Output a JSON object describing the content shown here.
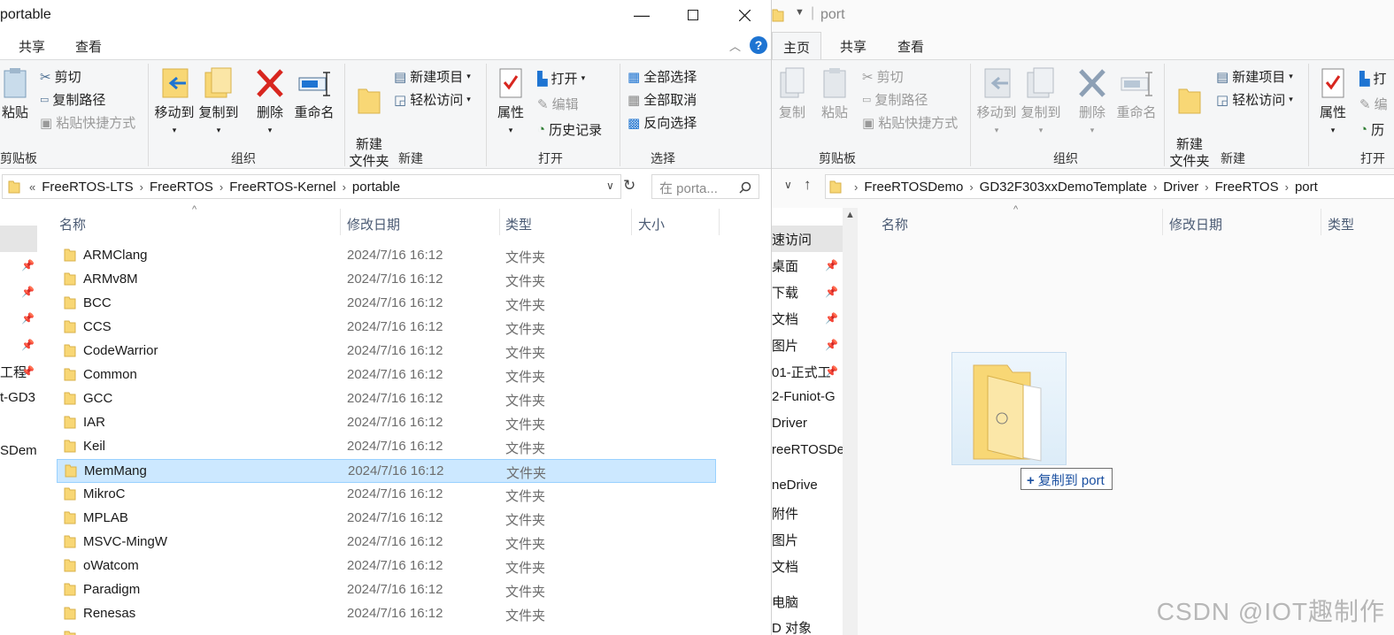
{
  "left_window": {
    "title": "portable",
    "tabs": [
      "共享",
      "查看"
    ],
    "ribbon": {
      "clipboard": {
        "group_label": "剪贴板",
        "paste": "粘贴",
        "cut": "剪切",
        "copy_path": "复制路径",
        "paste_shortcut": "粘贴快捷方式"
      },
      "organize": {
        "group_label": "组织",
        "move_to": "移动到",
        "copy_to": "复制到",
        "delete": "删除",
        "rename": "重命名"
      },
      "new": {
        "group_label": "新建",
        "new_folder": "新建\n文件夹",
        "new_item": "新建项目",
        "easy_access": "轻松访问"
      },
      "open": {
        "group_label": "打开",
        "properties": "属性",
        "open": "打开",
        "edit": "编辑",
        "history": "历史记录"
      },
      "select": {
        "group_label": "选择",
        "select_all": "全部选择",
        "select_none": "全部取消",
        "invert": "反向选择"
      }
    },
    "breadcrumbs": [
      "FreeRTOS-LTS",
      "FreeRTOS",
      "FreeRTOS-Kernel",
      "portable"
    ],
    "search_placeholder": "在 porta...",
    "columns": {
      "name": "名称",
      "date": "修改日期",
      "type": "类型",
      "size": "大小"
    },
    "nav_items": [
      "工程",
      "t-GD3",
      "SDem"
    ],
    "rows": [
      {
        "name": "ARMClang",
        "date": "2024/7/16 16:12",
        "type": "文件夹"
      },
      {
        "name": "ARMv8M",
        "date": "2024/7/16 16:12",
        "type": "文件夹"
      },
      {
        "name": "BCC",
        "date": "2024/7/16 16:12",
        "type": "文件夹"
      },
      {
        "name": "CCS",
        "date": "2024/7/16 16:12",
        "type": "文件夹"
      },
      {
        "name": "CodeWarrior",
        "date": "2024/7/16 16:12",
        "type": "文件夹"
      },
      {
        "name": "Common",
        "date": "2024/7/16 16:12",
        "type": "文件夹"
      },
      {
        "name": "GCC",
        "date": "2024/7/16 16:12",
        "type": "文件夹"
      },
      {
        "name": "IAR",
        "date": "2024/7/16 16:12",
        "type": "文件夹"
      },
      {
        "name": "Keil",
        "date": "2024/7/16 16:12",
        "type": "文件夹"
      },
      {
        "name": "MemMang",
        "date": "2024/7/16 16:12",
        "type": "文件夹",
        "selected": true
      },
      {
        "name": "MikroC",
        "date": "2024/7/16 16:12",
        "type": "文件夹"
      },
      {
        "name": "MPLAB",
        "date": "2024/7/16 16:12",
        "type": "文件夹"
      },
      {
        "name": "MSVC-MingW",
        "date": "2024/7/16 16:12",
        "type": "文件夹"
      },
      {
        "name": "oWatcom",
        "date": "2024/7/16 16:12",
        "type": "文件夹"
      },
      {
        "name": "Paradigm",
        "date": "2024/7/16 16:12",
        "type": "文件夹"
      },
      {
        "name": "Renesas",
        "date": "2024/7/16 16:12",
        "type": "文件夹"
      }
    ]
  },
  "right_window": {
    "title": "port",
    "tabs": [
      "主页",
      "共享",
      "查看"
    ],
    "ribbon": {
      "clipboard": {
        "group_label": "剪贴板",
        "copy": "复制",
        "paste": "粘贴",
        "cut": "剪切",
        "copy_path": "复制路径",
        "paste_shortcut": "粘贴快捷方式"
      },
      "organize": {
        "group_label": "组织",
        "move_to": "移动到",
        "copy_to": "复制到",
        "delete": "删除",
        "rename": "重命名"
      },
      "new": {
        "group_label": "新建",
        "new_folder": "新建\n文件夹",
        "new_item": "新建项目",
        "easy_access": "轻松访问"
      },
      "open": {
        "group_label": "打开",
        "properties": "属性",
        "open_partial": "打",
        "edit_partial": "编",
        "history_partial": "历"
      }
    },
    "breadcrumbs": [
      "FreeRTOSDemo",
      "GD32F303xxDemoTemplate",
      "Driver",
      "FreeRTOS",
      "port"
    ],
    "columns": {
      "name": "名称",
      "date": "修改日期",
      "type": "类型"
    },
    "nav_items": [
      "速访问",
      "桌面",
      "下载",
      "文档",
      "图片",
      "01-正式工",
      "2-Funiot-G",
      "Driver",
      "reeRTOSDe",
      "neDrive",
      "附件",
      "图片",
      "文档",
      "电脑",
      "D 对象"
    ],
    "drag_tooltip": "复制到 port",
    "drag_tooltip_plus": "+"
  },
  "watermark": "CSDN @IOT趣制作",
  "colors": {
    "selection_bg": "#cce8ff",
    "selection_border": "#99d1ff",
    "folder_yellow": "#f8d775",
    "accent_blue": "#1a4fa0",
    "help_blue": "#1e74d2"
  }
}
